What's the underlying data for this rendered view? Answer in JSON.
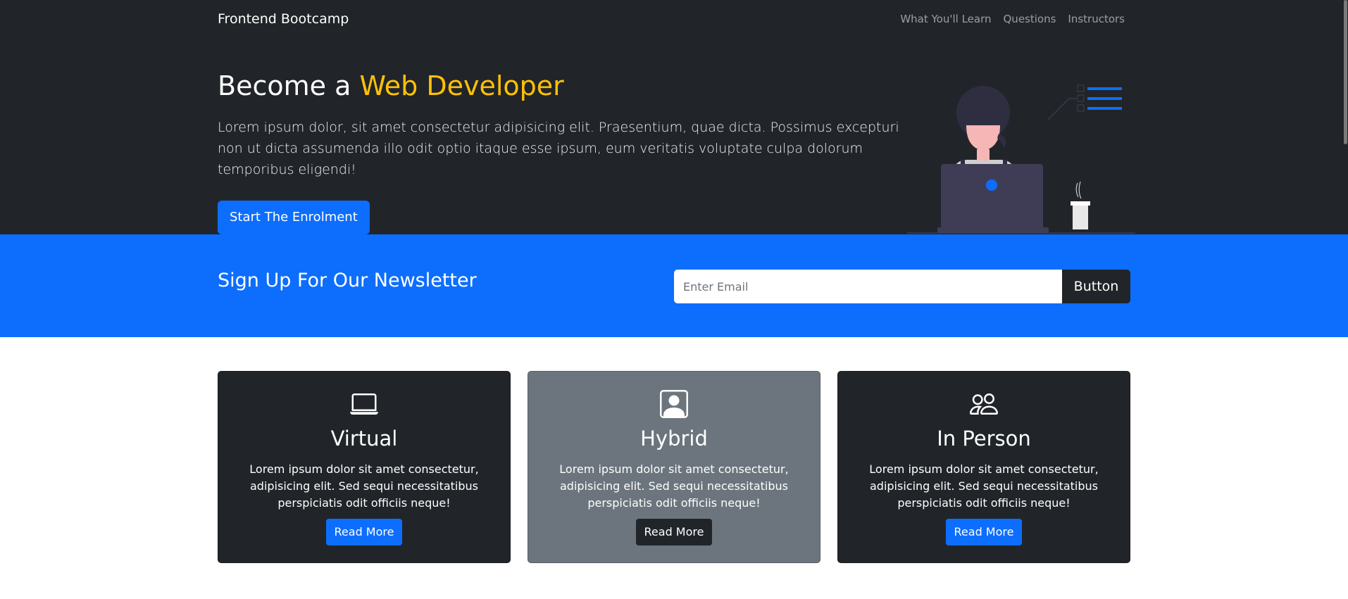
{
  "navbar": {
    "brand": "Frontend Bootcamp",
    "links": [
      {
        "label": "What You'll Learn"
      },
      {
        "label": "Questions"
      },
      {
        "label": "Instructors"
      }
    ]
  },
  "hero": {
    "title_prefix": "Become a ",
    "title_accent": "Web Developer",
    "lead": "Lorem ipsum dolor, sit amet consectetur adipisicing elit. Praesentium, quae dicta. Possimus excepturi non ut dicta assumenda illo odit optio itaque esse ipsum, eum veritatis voluptate culpa dolorum temporibus eligendi!",
    "button_label": "Start The Enrolment",
    "illustration_icon": "woman-with-laptop-illustration"
  },
  "newsletter": {
    "title": "Sign Up For Our Newsletter",
    "email_placeholder": "Enter Email",
    "email_value": "",
    "button_label": "Button"
  },
  "cards": [
    {
      "icon": "laptop-icon",
      "title": "Virtual",
      "text": "Lorem ipsum dolor sit amet consectetur, adipisicing elit. Sed sequi necessitatibus perspiciatis odit officiis neque!",
      "button_label": "Read More"
    },
    {
      "icon": "person-badge-icon",
      "title": "Hybrid",
      "text": "Lorem ipsum dolor sit amet consectetur, adipisicing elit. Sed sequi necessitatibus perspiciatis odit officiis neque!",
      "button_label": "Read More"
    },
    {
      "icon": "people-icon",
      "title": "In Person",
      "text": "Lorem ipsum dolor sit amet consectetur, adipisicing elit. Sed sequi necessitatibus perspiciatis odit officiis neque!",
      "button_label": "Read More"
    }
  ],
  "colors": {
    "dark": "#212529",
    "primary": "#0d6efd",
    "accent": "#ffc107",
    "secondary": "#6c757d"
  }
}
